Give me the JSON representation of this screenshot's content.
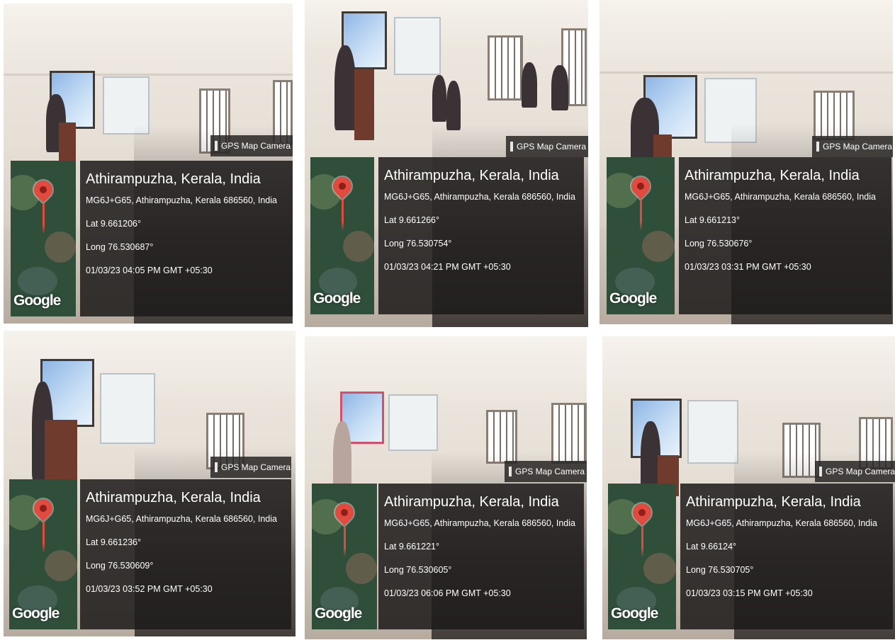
{
  "photos": [
    {
      "camera_label": "GPS Map Camera",
      "location": "Athirampuzha, Kerala, India",
      "address": "MG6J+G65, Athirampuzha, Kerala 686560, India",
      "lat": "Lat 9.661206°",
      "long": "Long 76.530687°",
      "datetime": "01/03/23 04:05 PM GMT +05:30",
      "map_logo": "Google"
    },
    {
      "camera_label": "GPS Map Camera",
      "location": "Athirampuzha, Kerala, India",
      "address": "MG6J+G65, Athirampuzha, Kerala 686560, India",
      "lat": "Lat 9.661266°",
      "long": "Long 76.530754°",
      "datetime": "01/03/23 04:21 PM GMT +05:30",
      "map_logo": "Google"
    },
    {
      "camera_label": "GPS Map Camera",
      "location": "Athirampuzha, Kerala, India",
      "address": "MG6J+G65, Athirampuzha, Kerala 686560, India",
      "lat": "Lat 9.661213°",
      "long": "Long 76.530676°",
      "datetime": "01/03/23 03:31 PM GMT +05:30",
      "map_logo": "Google"
    },
    {
      "camera_label": "GPS Map Camera",
      "location": "Athirampuzha, Kerala, India",
      "address": "MG6J+G65, Athirampuzha, Kerala 686560, India",
      "lat": "Lat 9.661236°",
      "long": "Long 76.530609°",
      "datetime": "01/03/23 03:52 PM GMT +05:30",
      "map_logo": "Google"
    },
    {
      "camera_label": "GPS Map Camera",
      "location": "Athirampuzha, Kerala, India",
      "address": "MG6J+G65, Athirampuzha, Kerala 686560, India",
      "lat": "Lat 9.661221°",
      "long": "Long 76.530605°",
      "datetime": "01/03/23 06:06 PM GMT +05:30",
      "map_logo": "Google"
    },
    {
      "camera_label": "GPS Map Camera",
      "location": "Athirampuzha, Kerala, India",
      "address": "MG6J+G65, Athirampuzha, Kerala 686560, India",
      "lat": "Lat 9.66124°",
      "long": "Long 76.530705°",
      "datetime": "01/03/23 03:15 PM GMT +05:30",
      "map_logo": "Google"
    }
  ],
  "colors": {
    "pin": "#e04a3f",
    "overlay": "#1c1a1a",
    "camera_icon": "#3c8d52"
  }
}
